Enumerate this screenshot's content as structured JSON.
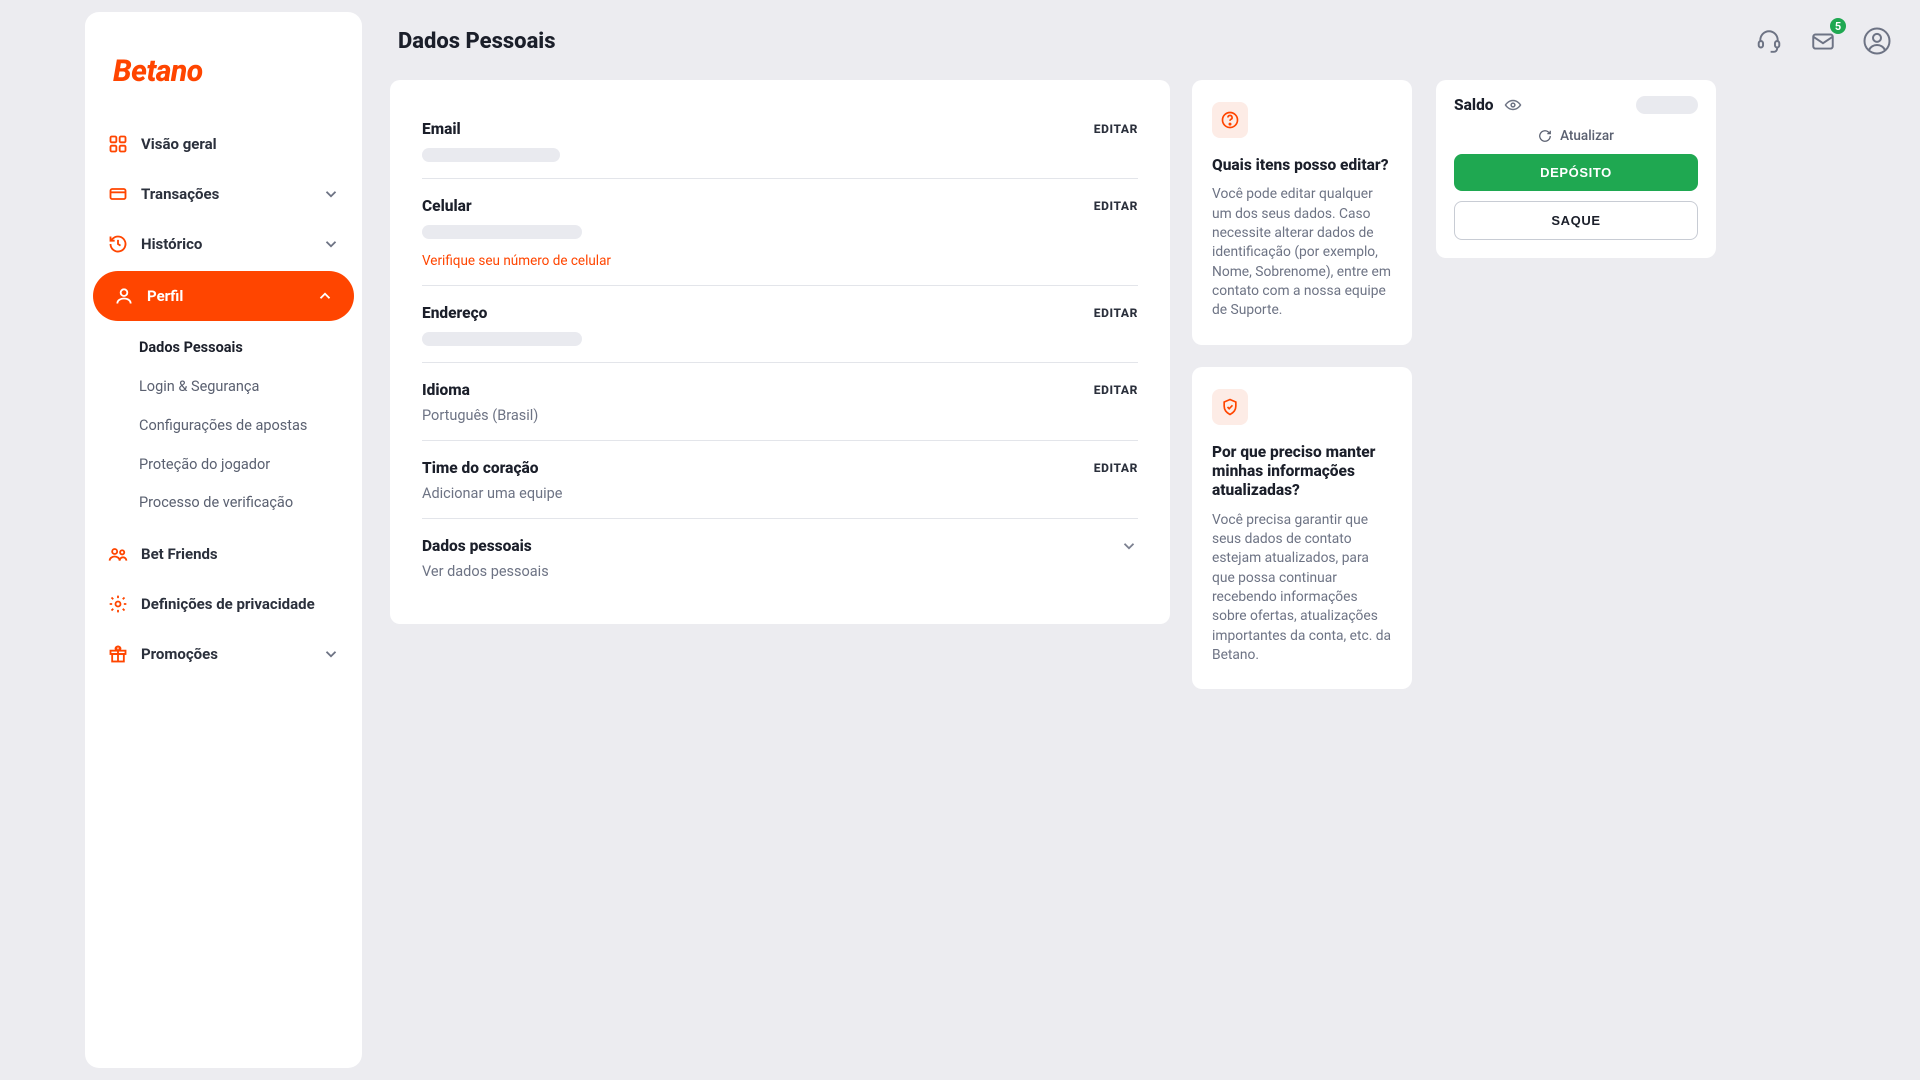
{
  "brand": "Betano",
  "page_title": "Dados Pessoais",
  "sidebar": {
    "items": [
      {
        "label": "Visão geral",
        "icon": "grid-icon",
        "expandable": false
      },
      {
        "label": "Transações",
        "icon": "card-icon",
        "expandable": true
      },
      {
        "label": "Histórico",
        "icon": "history-icon",
        "expandable": true
      },
      {
        "label": "Perfil",
        "icon": "user-icon",
        "expandable": true,
        "active": true
      },
      {
        "label": "Bet Friends",
        "icon": "friends-icon",
        "expandable": false
      },
      {
        "label": "Definições de privacidade",
        "icon": "gear-icon",
        "expandable": false
      },
      {
        "label": "Promoções",
        "icon": "gift-icon",
        "expandable": true
      }
    ],
    "profile_sub": [
      "Dados Pessoais",
      "Login & Segurança",
      "Configurações de apostas",
      "Proteção do jogador",
      "Processo de verificação"
    ]
  },
  "fields": {
    "email": {
      "title": "Email",
      "action": "EDITAR"
    },
    "phone": {
      "title": "Celular",
      "action": "EDITAR",
      "warning": "Verifique seu número de celular"
    },
    "address": {
      "title": "Endereço",
      "action": "EDITAR"
    },
    "language": {
      "title": "Idioma",
      "action": "EDITAR",
      "value": "Português (Brasil)"
    },
    "team": {
      "title": "Time do coração",
      "action": "EDITAR",
      "value": "Adicionar uma equipe"
    },
    "personal": {
      "title": "Dados pessoais",
      "value": "Ver dados pessoais"
    }
  },
  "info": {
    "edit": {
      "title": "Quais itens posso editar?",
      "text": "Você pode editar qualquer um dos seus dados. Caso necessite alterar dados de identificação (por exemplo, Nome, Sobrenome), entre em contato com a nossa equipe de Suporte."
    },
    "why": {
      "title": "Por que preciso manter minhas informações atualizadas?",
      "text": "Você precisa garantir que seus dados de contato estejam atualizados, para que possa continuar recebendo informações sobre ofertas, atualizações importantes da conta, etc. da Betano."
    }
  },
  "balance": {
    "label": "Saldo",
    "refresh": "Atualizar",
    "deposit": "DEPÓSITO",
    "withdraw": "SAQUE"
  },
  "topbar": {
    "mail_badge": "5"
  }
}
